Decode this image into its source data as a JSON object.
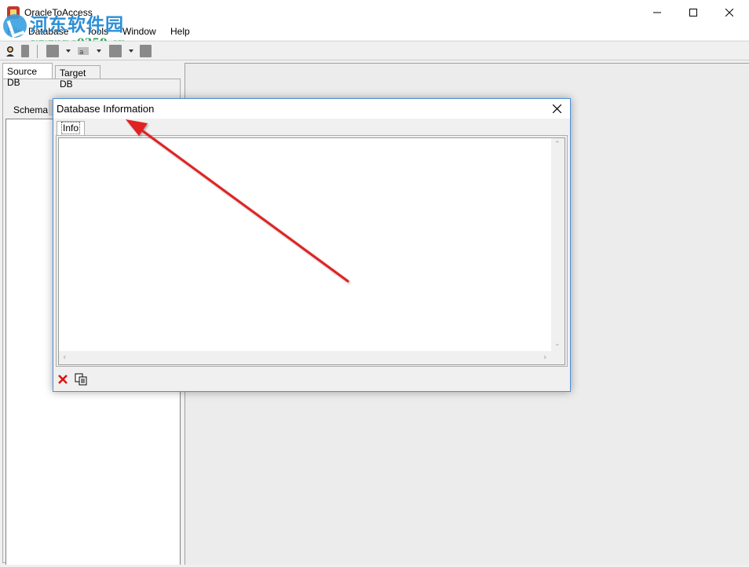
{
  "window": {
    "title": "OracleToAccess"
  },
  "watermark": {
    "text_cn": "河东软件园",
    "url": "www.pc0359.cn"
  },
  "menu": {
    "items": [
      "File",
      "Database",
      "Tools",
      "Window",
      "Help"
    ]
  },
  "left_panel": {
    "tabs": [
      "Source DB",
      "Target DB"
    ],
    "active_tab": "Source DB",
    "schema_label": "Schema",
    "schema_value": ""
  },
  "dialog": {
    "title": "Database Information",
    "tab": "Info",
    "content": "",
    "buttons": [
      "delete-icon",
      "copy-icon"
    ]
  },
  "colors": {
    "dialog_border": "#4a90d9",
    "annotation_arrow": "#e02020",
    "watermark_blue": "#2d8fd5",
    "watermark_green": "#2aa55a"
  }
}
